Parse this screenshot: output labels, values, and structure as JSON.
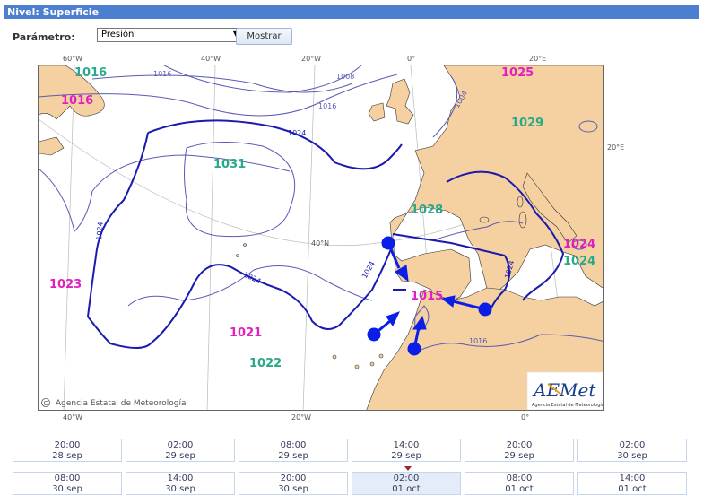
{
  "header": {
    "title": "Nivel: Superficie"
  },
  "param": {
    "label": "Parámetro:",
    "selected": "Presión",
    "button": "Mostrar"
  },
  "map": {
    "credit": "Agencia Estatal de Meteorología",
    "logo_text": "AEMet",
    "logo_subtitle": "Agencia Estatal de Meteorología",
    "top_axis": [
      "60°W",
      "40°W",
      "20°W",
      "0°",
      "20°E"
    ],
    "bottom_axis": [
      "40°W",
      "20°W",
      "0°"
    ],
    "right_axis": [
      "20°E"
    ],
    "lat_label": "40°N",
    "isobar_labels": [
      "1008",
      "1016",
      "1016",
      "1016",
      "1024",
      "1024",
      "1024",
      "1024",
      "1024",
      "1016",
      "1004"
    ],
    "pressure_values": [
      {
        "value": "1016",
        "kind": "low"
      },
      {
        "value": "1016",
        "kind": "high"
      },
      {
        "value": "1025",
        "kind": "high"
      },
      {
        "value": "1029",
        "kind": "low"
      },
      {
        "value": "1031",
        "kind": "low"
      },
      {
        "value": "1028",
        "kind": "low"
      },
      {
        "value": "1023",
        "kind": "high"
      },
      {
        "value": "1015",
        "kind": "high"
      },
      {
        "value": "1021",
        "kind": "high"
      },
      {
        "value": "1022",
        "kind": "low"
      },
      {
        "value": "1024",
        "kind": "high"
      },
      {
        "value": "1024",
        "kind": "low"
      }
    ],
    "colors": {
      "land": "#f5d0a0",
      "sea": "#ffffff",
      "isobar": "#5a5ab5",
      "isobar_bold": "#1a1ab0",
      "high": "#e020c0",
      "low": "#2aa88a",
      "arrow": "#0a1ee8"
    }
  },
  "times": [
    {
      "time": "20:00",
      "date": "28 sep"
    },
    {
      "time": "02:00",
      "date": "29 sep"
    },
    {
      "time": "08:00",
      "date": "29 sep"
    },
    {
      "time": "14:00",
      "date": "29 sep"
    },
    {
      "time": "20:00",
      "date": "29 sep"
    },
    {
      "time": "02:00",
      "date": "30 sep"
    },
    {
      "time": "08:00",
      "date": "30 sep"
    },
    {
      "time": "14:00",
      "date": "30 sep"
    },
    {
      "time": "20:00",
      "date": "30 sep"
    },
    {
      "time": "02:00",
      "date": "01 oct"
    },
    {
      "time": "08:00",
      "date": "01 oct"
    },
    {
      "time": "14:00",
      "date": "01 oct"
    }
  ],
  "active_time_index": 9
}
